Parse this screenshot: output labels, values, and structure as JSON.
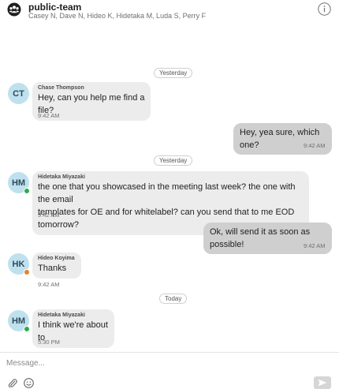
{
  "header": {
    "team_name": "public-team",
    "members": "Casey N, Dave N, Hideo K, Hidetaka M, Luda S, Perry F"
  },
  "messages": [
    {
      "type": "separator",
      "label": "Yesterday"
    },
    {
      "type": "incoming",
      "avatar": "CT",
      "presence": "none",
      "sender": "Chase Thompson",
      "text": "Hey, can you help me find a file?",
      "time": "9:42 AM"
    },
    {
      "type": "outgoing",
      "text": "Hey, yea sure, which one?",
      "time": "9:42 AM"
    },
    {
      "type": "separator",
      "label": "Yesterday"
    },
    {
      "type": "incoming",
      "avatar": "HM",
      "presence": "online",
      "sender": "Hidetaka Miyazaki",
      "lines": [
        "the one that you showcased in the meeting last week? the one with the email",
        "templates for OE and for whitelabel? can you  send that to me EOD tomorrow?"
      ],
      "time": "9:42 AM"
    },
    {
      "type": "outgoing",
      "text": "Ok, will send it as soon as possible!",
      "time": "9:42 AM"
    },
    {
      "type": "incoming",
      "avatar": "HK",
      "presence": "away",
      "sender": "Hideo Koyima",
      "text": "Thanks",
      "time": "9:42 AM"
    },
    {
      "type": "separator",
      "label": "Today"
    },
    {
      "type": "incoming",
      "avatar": "HM",
      "presence": "online",
      "sender": "Hidetaka Miyazaki",
      "text": "I think we're about to",
      "time": "5:30 PM"
    }
  ],
  "composer": {
    "placeholder": "Message...",
    "icons": [
      "paperclip-icon",
      "emoji-icon",
      "send-icon"
    ]
  },
  "colors": {
    "avatar_bg": "#bfe1ee",
    "incoming_bubble": "#ececec",
    "outgoing_bubble": "#cfcfcf",
    "online": "#2eaa4a",
    "away": "#e9812d"
  }
}
